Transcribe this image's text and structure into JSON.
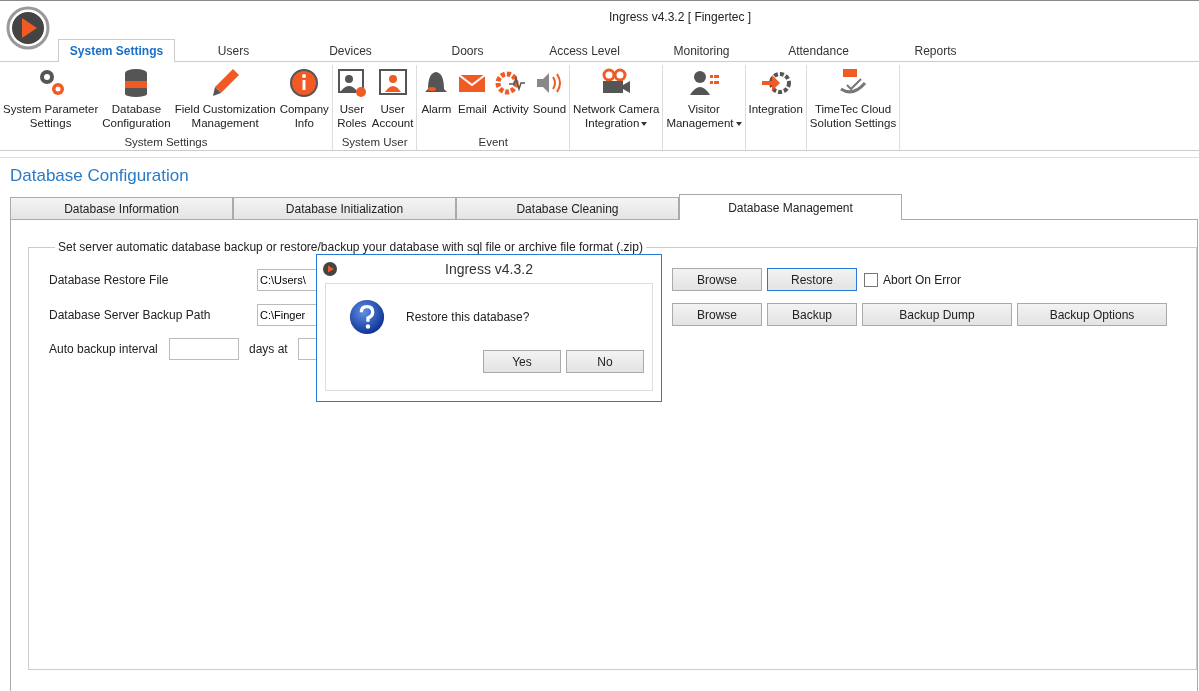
{
  "window": {
    "title": "Ingress v4.3.2 [ Fingertec ]"
  },
  "ribbon_tabs": [
    {
      "label": "System Settings",
      "selected": true
    },
    {
      "label": "Users",
      "selected": false
    },
    {
      "label": "Devices",
      "selected": false
    },
    {
      "label": "Doors",
      "selected": false
    },
    {
      "label": "Access Level",
      "selected": false
    },
    {
      "label": "Monitoring",
      "selected": false
    },
    {
      "label": "Attendance",
      "selected": false
    },
    {
      "label": "Reports",
      "selected": false
    }
  ],
  "ribbon_groups": [
    {
      "label": "System Settings",
      "items": [
        {
          "lines": [
            "System Parameter",
            "Settings"
          ],
          "dropdown": false
        },
        {
          "lines": [
            "Database",
            "Configuration"
          ],
          "dropdown": false
        },
        {
          "lines": [
            "Field Customization",
            "Management"
          ],
          "dropdown": false
        },
        {
          "lines": [
            "Company",
            "Info"
          ],
          "dropdown": false
        }
      ]
    },
    {
      "label": "System User",
      "items": [
        {
          "lines": [
            "User",
            "Roles"
          ],
          "dropdown": false
        },
        {
          "lines": [
            "User",
            "Account"
          ],
          "dropdown": false
        }
      ]
    },
    {
      "label": "Event",
      "items": [
        {
          "lines": [
            "Alarm"
          ],
          "dropdown": false
        },
        {
          "lines": [
            "Email"
          ],
          "dropdown": false
        },
        {
          "lines": [
            "Activity"
          ],
          "dropdown": false
        },
        {
          "lines": [
            "Sound"
          ],
          "dropdown": false
        }
      ]
    },
    {
      "items": [
        {
          "lines": [
            "Network Camera",
            "Integration"
          ],
          "dropdown": true
        }
      ]
    },
    {
      "items": [
        {
          "lines": [
            "Visitor",
            "Management"
          ],
          "dropdown": true
        }
      ]
    },
    {
      "items": [
        {
          "lines": [
            "Integration"
          ],
          "dropdown": false
        }
      ]
    },
    {
      "items": [
        {
          "lines": [
            "TimeTec Cloud",
            "Solution Settings"
          ],
          "dropdown": false
        }
      ]
    }
  ],
  "page": {
    "title": "Database Configuration",
    "tabs": [
      {
        "label": "Database Information",
        "selected": false
      },
      {
        "label": "Database Initialization",
        "selected": false
      },
      {
        "label": "Database Cleaning",
        "selected": false
      },
      {
        "label": "Database Management",
        "selected": true
      }
    ],
    "group_title": "Set server automatic database backup or restore/backup your database with sql file or archive file format (.zip)",
    "restore": {
      "label": "Database Restore File",
      "value": "C:\\Users\\",
      "buttons": [
        "Browse",
        "Restore"
      ],
      "abort_on_error": {
        "label": "Abort On Error",
        "checked": false
      }
    },
    "backup": {
      "label": "Database Server Backup Path",
      "value": "C:\\Finger",
      "buttons": [
        "Browse",
        "Backup",
        "Backup Dump",
        "Backup Options"
      ]
    },
    "auto_backup": {
      "label": "Auto backup interval",
      "unit": "days at"
    }
  },
  "dialog": {
    "title": "Ingress v4.3.2",
    "message": "Restore this database?",
    "buttons": [
      "Yes",
      "No"
    ]
  }
}
